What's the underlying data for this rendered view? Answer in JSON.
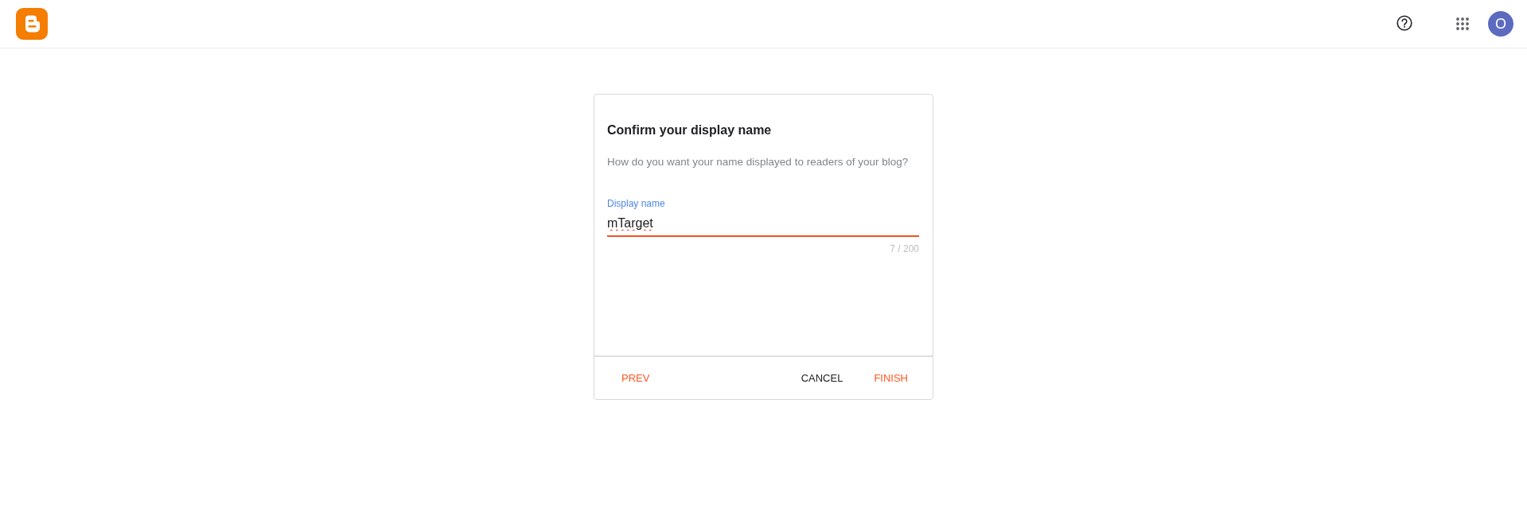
{
  "header": {
    "avatar": {
      "initial": "O"
    }
  },
  "dialog": {
    "title": "Confirm your display name",
    "subtitle": "How do you want your name displayed to readers of your blog?",
    "field": {
      "label": "Display name",
      "value": "mTarget",
      "counter": "7 / 200",
      "focused": true,
      "misspelled": true
    },
    "buttons": {
      "left": [
        {
          "label": "PREV",
          "kind": "accent"
        }
      ],
      "right": [
        {
          "label": "CANCEL",
          "kind": "plain"
        },
        {
          "label": "FINISH",
          "kind": "accent"
        }
      ]
    }
  }
}
